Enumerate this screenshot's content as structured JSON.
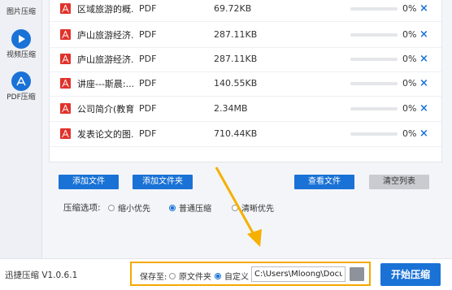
{
  "sidebar": {
    "items": [
      {
        "label": "图片压缩",
        "icon": "image-icon"
      },
      {
        "label": "视频压缩",
        "icon": "play-icon"
      },
      {
        "label": "PDF压缩",
        "icon": "pdf-icon"
      }
    ]
  },
  "files": [
    {
      "name": "区域旅游的概...",
      "type": "PDF",
      "size": "69.72KB",
      "progress": "0%",
      "progress_fraction": 0
    },
    {
      "name": "庐山旅游经济...",
      "type": "PDF",
      "size": "287.11KB",
      "progress": "0%",
      "progress_fraction": 0
    },
    {
      "name": "庐山旅游经济...",
      "type": "PDF",
      "size": "287.11KB",
      "progress": "0%",
      "progress_fraction": 0
    },
    {
      "name": "讲座---斯晨:...",
      "type": "PDF",
      "size": "140.55KB",
      "progress": "0%",
      "progress_fraction": 0
    },
    {
      "name": "公司简介(教育...",
      "type": "PDF",
      "size": "2.34MB",
      "progress": "0%",
      "progress_fraction": 0
    },
    {
      "name": "发表论文的图...",
      "type": "PDF",
      "size": "710.44KB",
      "progress": "0%",
      "progress_fraction": 0
    }
  ],
  "delete_glyph": "×",
  "buttons": {
    "add_file": "添加文件",
    "add_folder": "添加文件夹",
    "view_file": "查看文件",
    "clear_list": "清空列表"
  },
  "compression": {
    "title": "压缩选项:",
    "options": [
      {
        "label": "缩小优先",
        "selected": false
      },
      {
        "label": "普通压缩",
        "selected": true
      },
      {
        "label": "清晰优先",
        "selected": false
      }
    ]
  },
  "footer": {
    "version": "迅捷压缩 V1.0.6.1",
    "save_to": "保存至:",
    "original_folder": "原文件夹",
    "custom": "自定义",
    "path_value": "C:\\Users\\Mloong\\Docume",
    "start": "开始压缩"
  },
  "colors": {
    "accent": "#1a72d6",
    "highlight": "#f5a800"
  }
}
